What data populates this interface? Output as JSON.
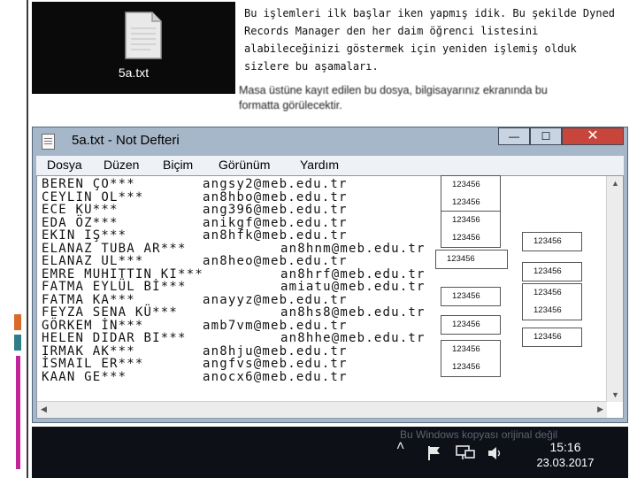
{
  "desktop": {
    "file_label": "5a.txt"
  },
  "intro_text": "Bu işlemleri ilk başlar iken yapmış idik. Bu şekilde Dyned Records Manager den her daim öğrenci listesini alabileceğinizi göstermek için yeniden işlemiş olduk sizlere bu aşamaları.",
  "caption_text": "Masa üstüne kayıt edilen bu dosya, bilgisayarınız ekranında bu formatta görülecektir.",
  "window": {
    "title": "5a.txt - Not Defteri",
    "min_label": "—",
    "max_label": "☐",
    "close_label": "✕",
    "menu": [
      "Dosya",
      "Düzen",
      "Biçim",
      "Görünüm",
      "Yardım"
    ]
  },
  "records": [
    {
      "name": "BEREN ÇO***",
      "email": "angsy2@meb.edu.tr",
      "indent": 0
    },
    {
      "name": "CEYLIN OL***",
      "email": "an8hbo@meb.edu.tr",
      "indent": 0
    },
    {
      "name": "ECE KU***",
      "email": "ang396@meb.edu.tr",
      "indent": 0
    },
    {
      "name": "EDA ÖZ***",
      "email": "anikgf@meb.edu.tr",
      "indent": 0
    },
    {
      "name": "EKIN IŞ***",
      "email": "an8hfk@meb.edu.tr",
      "indent": 0
    },
    {
      "name": "ELANAZ TUBA AR***",
      "email": "an8hnm@meb.edu.tr",
      "indent": 1
    },
    {
      "name": "ELANAZ UL***",
      "email": "an8heo@meb.edu.tr",
      "indent": 0
    },
    {
      "name": "EMRE MUHITTIN KI***",
      "email": "an8hrf@meb.edu.tr",
      "indent": 1
    },
    {
      "name": "FATMA EYLÜL Bİ***",
      "email": "amiatu@meb.edu.tr",
      "indent": 1
    },
    {
      "name": "FATMA KA***",
      "email": "anayyz@meb.edu.tr",
      "indent": 0
    },
    {
      "name": "FEYZA SENA KÜ***",
      "email": "an8hs8@meb.edu.tr",
      "indent": 1
    },
    {
      "name": "GÖRKEM İN***",
      "email": "amb7vm@meb.edu.tr",
      "indent": 0
    },
    {
      "name": "HELEN DIDAR BI***",
      "email": "an8hhe@meb.edu.tr",
      "indent": 1
    },
    {
      "name": "IRMAK AK***",
      "email": "an8hju@meb.edu.tr",
      "indent": 0
    },
    {
      "name": "İSMAIL ER***",
      "email": "angfvs@meb.edu.tr",
      "indent": 0
    },
    {
      "name": "KAAN GE***",
      "email": "anocx6@meb.edu.tr",
      "indent": 0
    }
  ],
  "password_boxes": [
    [
      "123456",
      "123456"
    ],
    [
      "123456",
      "123456"
    ],
    [
      "123456"
    ],
    [
      "123456"
    ],
    [
      "123456"
    ],
    [
      "123456",
      "123456"
    ],
    [
      "123456"
    ],
    [
      "123456"
    ],
    [
      "123456"
    ],
    [
      "123456",
      "123456"
    ]
  ],
  "taskbar": {
    "watermark": "Bu Windows kopyası orijinal değil",
    "time": "15:16",
    "date": "23.03.2017"
  },
  "colors": {
    "window_frame": "#a6b7c9",
    "close_button": "#c7453b",
    "desktop": "#0a0a0a",
    "deco_orange": "#d86a2a",
    "deco_teal": "#2e7d8a",
    "deco_magenta": "#c0269a"
  }
}
